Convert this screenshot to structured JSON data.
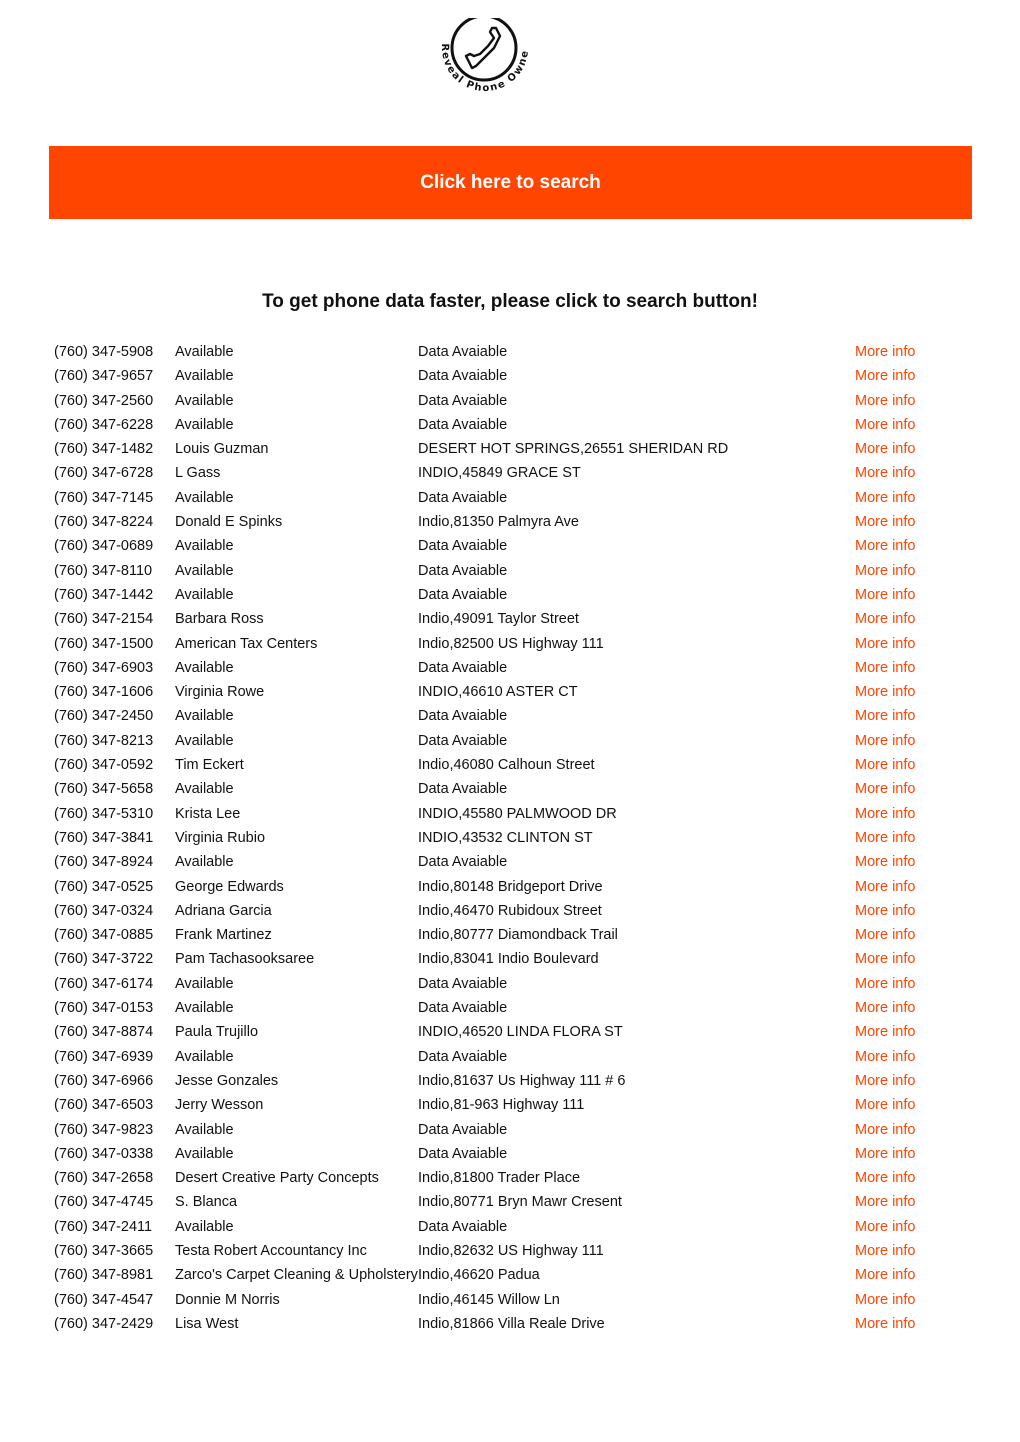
{
  "logo": {
    "text": "Reveal Phone Owner",
    "icon": "phone-handset-icon"
  },
  "banner": {
    "label": "Click here to search",
    "color": "#ff4500"
  },
  "headline": "To get phone data faster, please click to search button!",
  "more_info_label": "More info",
  "rows": [
    {
      "phone": "(760) 347-5908",
      "name": "Available",
      "address": "Data Avaiable"
    },
    {
      "phone": "(760) 347-9657",
      "name": "Available",
      "address": "Data Avaiable"
    },
    {
      "phone": "(760) 347-2560",
      "name": "Available",
      "address": "Data Avaiable"
    },
    {
      "phone": "(760) 347-6228",
      "name": "Available",
      "address": "Data Avaiable"
    },
    {
      "phone": "(760) 347-1482",
      "name": "Louis Guzman",
      "address": "DESERT HOT SPRINGS,26551 SHERIDAN RD"
    },
    {
      "phone": "(760) 347-6728",
      "name": "L Gass",
      "address": "INDIO,45849 GRACE ST"
    },
    {
      "phone": "(760) 347-7145",
      "name": "Available",
      "address": "Data Avaiable"
    },
    {
      "phone": "(760) 347-8224",
      "name": "Donald E Spinks",
      "address": "Indio,81350 Palmyra Ave"
    },
    {
      "phone": "(760) 347-0689",
      "name": "Available",
      "address": "Data Avaiable"
    },
    {
      "phone": "(760) 347-8110",
      "name": "Available",
      "address": "Data Avaiable"
    },
    {
      "phone": "(760) 347-1442",
      "name": "Available",
      "address": "Data Avaiable"
    },
    {
      "phone": "(760) 347-2154",
      "name": "Barbara Ross",
      "address": "Indio,49091 Taylor Street"
    },
    {
      "phone": "(760) 347-1500",
      "name": "American Tax Centers",
      "address": "Indio,82500 US Highway 111"
    },
    {
      "phone": "(760) 347-6903",
      "name": "Available",
      "address": "Data Avaiable"
    },
    {
      "phone": "(760) 347-1606",
      "name": "Virginia Rowe",
      "address": "INDIO,46610 ASTER CT"
    },
    {
      "phone": "(760) 347-2450",
      "name": "Available",
      "address": "Data Avaiable"
    },
    {
      "phone": "(760) 347-8213",
      "name": "Available",
      "address": "Data Avaiable"
    },
    {
      "phone": "(760) 347-0592",
      "name": "Tim Eckert",
      "address": "Indio,46080 Calhoun Street"
    },
    {
      "phone": "(760) 347-5658",
      "name": "Available",
      "address": "Data Avaiable"
    },
    {
      "phone": "(760) 347-5310",
      "name": "Krista Lee",
      "address": "INDIO,45580 PALMWOOD DR"
    },
    {
      "phone": "(760) 347-3841",
      "name": "Virginia Rubio",
      "address": "INDIO,43532 CLINTON ST"
    },
    {
      "phone": "(760) 347-8924",
      "name": "Available",
      "address": "Data Avaiable"
    },
    {
      "phone": "(760) 347-0525",
      "name": "George Edwards",
      "address": "Indio,80148 Bridgeport Drive"
    },
    {
      "phone": "(760) 347-0324",
      "name": "Adriana Garcia",
      "address": "Indio,46470 Rubidoux Street"
    },
    {
      "phone": "(760) 347-0885",
      "name": "Frank Martinez",
      "address": "Indio,80777 Diamondback Trail"
    },
    {
      "phone": "(760) 347-3722",
      "name": "Pam Tachasooksaree",
      "address": "Indio,83041 Indio Boulevard"
    },
    {
      "phone": "(760) 347-6174",
      "name": "Available",
      "address": "Data Avaiable"
    },
    {
      "phone": "(760) 347-0153",
      "name": "Available",
      "address": "Data Avaiable"
    },
    {
      "phone": "(760) 347-8874",
      "name": "Paula Trujillo",
      "address": "INDIO,46520 LINDA FLORA ST"
    },
    {
      "phone": "(760) 347-6939",
      "name": "Available",
      "address": "Data Avaiable"
    },
    {
      "phone": "(760) 347-6966",
      "name": "Jesse Gonzales",
      "address": "Indio,81637 Us Highway 111 # 6"
    },
    {
      "phone": "(760) 347-6503",
      "name": "Jerry Wesson",
      "address": "Indio,81-963 Highway 111"
    },
    {
      "phone": "(760) 347-9823",
      "name": "Available",
      "address": "Data Avaiable"
    },
    {
      "phone": "(760) 347-0338",
      "name": "Available",
      "address": "Data Avaiable"
    },
    {
      "phone": "(760) 347-2658",
      "name": "Desert Creative Party Concepts",
      "address": "Indio,81800 Trader Place"
    },
    {
      "phone": "(760) 347-4745",
      "name": "S. Blanca",
      "address": "Indio,80771 Bryn Mawr Cresent"
    },
    {
      "phone": "(760) 347-2411",
      "name": "Available",
      "address": "Data Avaiable"
    },
    {
      "phone": "(760) 347-3665",
      "name": "Testa Robert Accountancy Inc",
      "address": "Indio,82632 US Highway 111"
    },
    {
      "phone": "(760) 347-8981",
      "name": "Zarco's Carpet Cleaning & Upholstery",
      "address": "Indio,46620 Padua"
    },
    {
      "phone": "(760) 347-4547",
      "name": "Donnie M Norris",
      "address": "Indio,46145 Willow Ln"
    },
    {
      "phone": "(760) 347-2429",
      "name": "Lisa West",
      "address": "Indio,81866 Villa Reale Drive"
    }
  ]
}
